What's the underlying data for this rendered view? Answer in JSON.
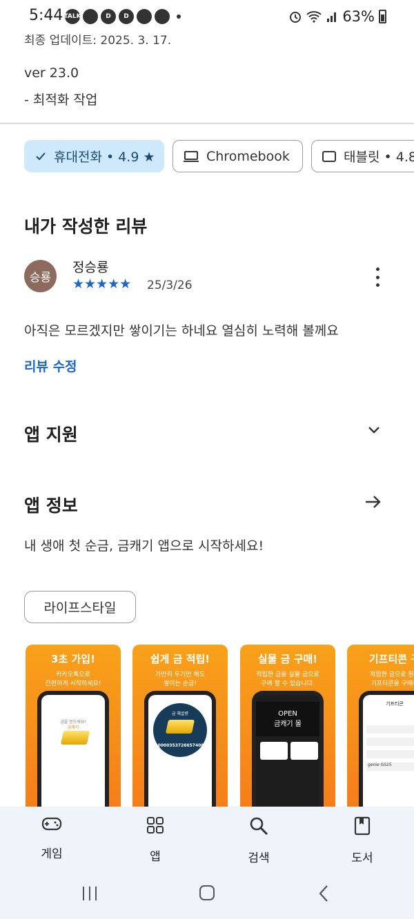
{
  "status_bar": {
    "time": "5:44",
    "app_icons": [
      "TALK",
      "chat",
      "D",
      "D",
      "img",
      "chat"
    ],
    "battery": "63%"
  },
  "whats_new": {
    "updated": "최종 업데이트: 2025. 3. 17.",
    "version": "ver 23.0",
    "note": "- 최적화 작업"
  },
  "device_chips": [
    {
      "label": "휴대전화 • 4.9 ★",
      "selected": true,
      "icon": "check-icon"
    },
    {
      "label": "Chromebook",
      "selected": false,
      "icon": "laptop-icon"
    },
    {
      "label": "태블릿 • 4.8",
      "selected": false,
      "icon": "tablet-icon"
    }
  ],
  "my_review": {
    "title": "내가 작성한 리뷰",
    "avatar": "승룡",
    "name": "정승룡",
    "stars": "★★★★★",
    "rating": 5,
    "date": "25/3/26",
    "text": "아직은 모르겠지만 쌓이기는 하네요 열심히 노력해 볼께요",
    "edit_label": "리뷰 수정"
  },
  "app_support": {
    "title": "앱 지원"
  },
  "app_info": {
    "title": "앱 정보",
    "description": "내 생애 첫 순금, 금캐기 앱으로 시작하세요!",
    "category": "라이프스타일"
  },
  "screenshots": [
    {
      "title": "3초 가입!",
      "sub": "카카오톡으로\n간편하게 시작하세요!",
      "screen_top": "금을 얻으세요!",
      "screen_sub": "금캐기"
    },
    {
      "title": "쉽게 금 적립!",
      "sub": "가만히 두기만 해도\n쌓이는 순금!",
      "screen_top": "금 채굴량",
      "screen_sub": "0.000035372665740​8g"
    },
    {
      "title": "실물 금 구매!",
      "sub": "적립한 금을 실물 금으로\n구매 할 수 있습니다.",
      "screen_top": "OPEN",
      "screen_sub": "금캐기 몰"
    },
    {
      "title": "기프티콘 구",
      "sub": "적립한 금으로 원하\n기프티콘을 구매하",
      "screen_top": "기프티콘",
      "screen_sub": "genie  GS25"
    }
  ],
  "bottom_nav": [
    {
      "label": "게임",
      "icon": "gamepad-icon"
    },
    {
      "label": "앱",
      "icon": "apps-grid-icon"
    },
    {
      "label": "검색",
      "icon": "search-icon"
    },
    {
      "label": "도서",
      "icon": "book-icon"
    }
  ],
  "colors": {
    "accent": "#1a66c9",
    "chip_selected": "#cde9fb",
    "avatar": "#8c6b5e",
    "screenshot_bg": "#f8a11a",
    "nav_bg": "#eff3fa"
  }
}
